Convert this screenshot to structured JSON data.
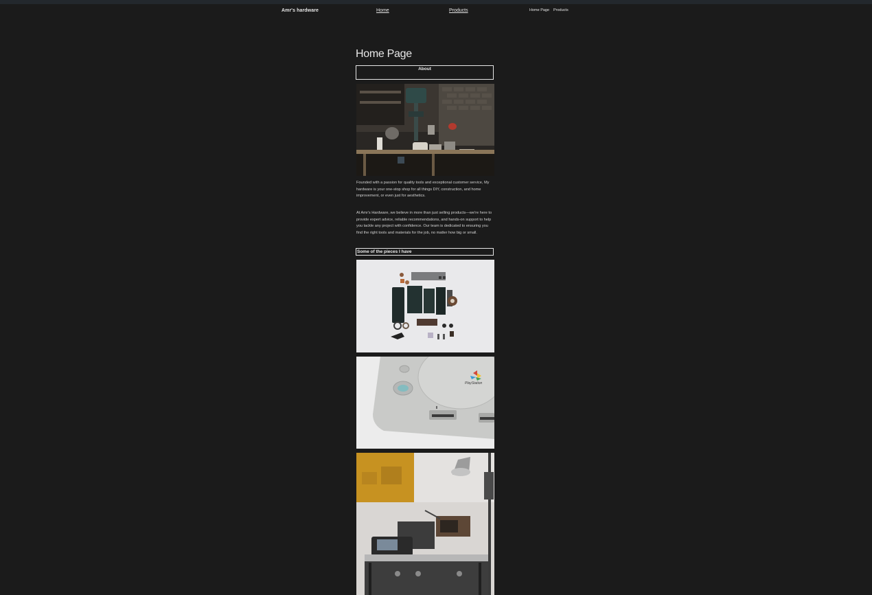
{
  "nav": {
    "brand": "Amr's hardware",
    "links": [
      "Home",
      "Products"
    ],
    "small_links": [
      "Home Page",
      "Products"
    ]
  },
  "main": {
    "title": "Home Page",
    "about_heading": "About",
    "paragraphs": [
      "Founded with a passion for quality tools and exceptional customer service, My hardware is your one-stop shop for all things DIY, construction, and home improvement, or even just for aesthetics.",
      "At Amr's Hardware, we believe in more than just selling products—we're here to provide expert advice, reliable recommendations, and hands-on support to help you tackle any project with confidence. Our team is dedicated to ensuring you find the right tools and materials for the job, no matter how big or small."
    ],
    "pieces_heading": "Some of the pieces I have",
    "console_logo_text": "PlayStation"
  },
  "colors": {
    "background": "#1b1b1b",
    "top_bar": "#23282d",
    "text": "#e8e8e8"
  },
  "images": [
    "workshop-photo",
    "disassembled-parts-photo",
    "game-console-photo",
    "studio-equipment-photo"
  ]
}
